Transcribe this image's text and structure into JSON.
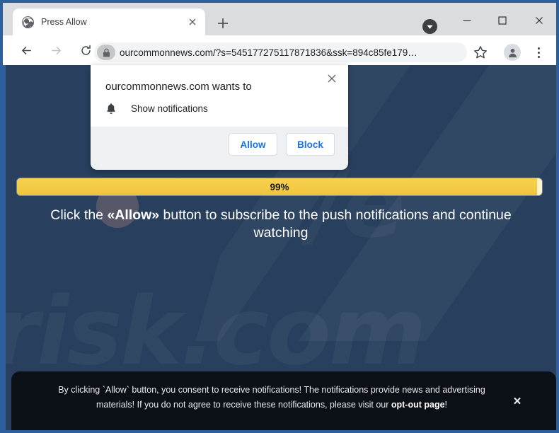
{
  "window": {
    "minimize_label": "Minimize",
    "maximize_label": "Maximize",
    "close_label": "Close",
    "download_icon": "download-chevron-icon"
  },
  "tabstrip": {
    "tab_title": "Press Allow",
    "tab_favicon": "globe-icon",
    "tab_close_label": "×",
    "new_tab_label": "+"
  },
  "toolbar": {
    "back_label": "Back",
    "forward_label": "Forward",
    "reload_label": "Reload",
    "url": "ourcommonnews.com/?s=545177275117871836&ssk=894c85fe179…",
    "lock_icon": "lock-icon",
    "bookmark_icon": "star-icon",
    "profile_icon": "person-icon",
    "menu_icon": "three-dot-menu-icon"
  },
  "dialog": {
    "title": "ourcommonnews.com wants to",
    "close_label": "×",
    "permission_icon": "bell-icon",
    "permission_label": "Show notifications",
    "allow_label": "Allow",
    "block_label": "Block",
    "accent_color": "#1a73e8"
  },
  "page": {
    "progress_percent": "99%",
    "progress_value": 99,
    "progress_color": "#f3cb45",
    "headline_prefix": "Click the ",
    "headline_emphasis": "«Allow»",
    "headline_suffix": " button to subscribe to the push notifications and continue watching",
    "watermark_text": "risk.com",
    "watermark_top_text": "/e",
    "background_color": "#28405e"
  },
  "banner": {
    "text_part1": "By clicking `Allow` button, you consent to receive notifications! The notifications provide news and advertising materials! If you do not agree to receive these notifications, please visit our ",
    "link_label": "opt-out page",
    "text_part2": "!",
    "close_label": "✕",
    "background_color": "#0b0f16"
  }
}
